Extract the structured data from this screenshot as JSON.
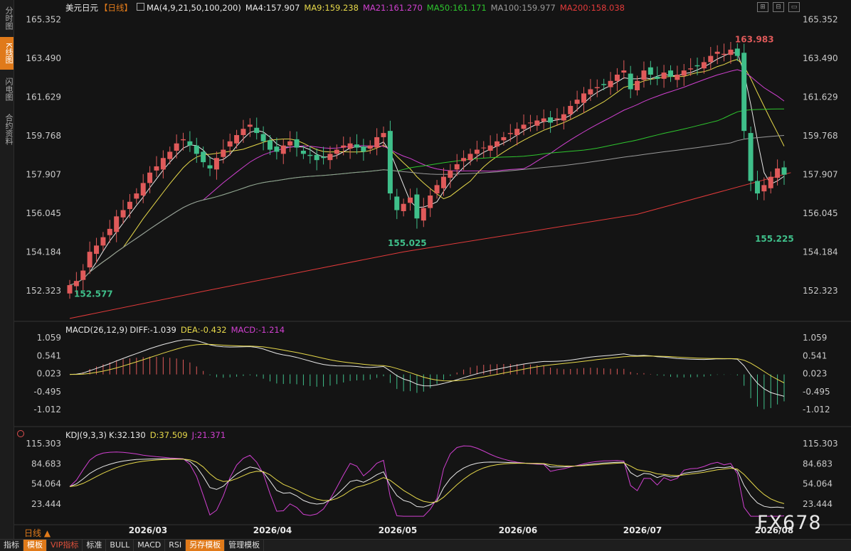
{
  "sidebar": {
    "tabs": [
      "分时图",
      "K线图",
      "闪电图",
      "合约资料"
    ],
    "active": 1
  },
  "header": {
    "symbol": "美元日元",
    "period": "【日线】",
    "ma_params": "MA(4,9,21,50,100,200)",
    "ma_values": [
      {
        "label": "MA4:157.907",
        "color": "#e8e8e8"
      },
      {
        "label": "MA9:159.238",
        "color": "#e6d84a"
      },
      {
        "label": "MA21:161.270",
        "color": "#d040d0"
      },
      {
        "label": "MA50:161.171",
        "color": "#2ec62e"
      },
      {
        "label": "MA100:159.977",
        "color": "#9a9a9a"
      },
      {
        "label": "MA200:158.038",
        "color": "#e23a3a"
      }
    ]
  },
  "macd_legend": {
    "title": "MACD(26,12,9)",
    "diff": "DIFF:-1.039",
    "dea": "DEA:-0.432",
    "macd": "MACD:-1.214"
  },
  "kdj_legend": {
    "title": "KDJ(9,3,3)",
    "k": "K:32.130",
    "d": "D:37.509",
    "j": "J:21.371"
  },
  "bottom_bar": {
    "tabs": [
      "指标",
      "模板",
      "VIP指标",
      "标准",
      "BULL",
      "MACD",
      "RSI",
      "另存模板",
      "管理模板"
    ]
  },
  "period_label": "日线 ▲",
  "watermark": "FX678",
  "chart_data": {
    "type": "candlestick",
    "title": "美元日元",
    "price_axis": {
      "ticks": [
        "165.352",
        "163.490",
        "161.629",
        "159.768",
        "157.907",
        "156.045",
        "154.184",
        "152.323"
      ],
      "ylim": [
        150.93,
        165.6
      ]
    },
    "macd_axis": {
      "ticks": [
        "1.059",
        "0.541",
        "0.023",
        "-0.495",
        "-1.012"
      ]
    },
    "kdj_axis": {
      "ticks": [
        "115.303",
        "84.683",
        "54.064",
        "23.444"
      ]
    },
    "x_labels": [
      "2026/03",
      "2026/04",
      "2026/05",
      "2026/06",
      "2026/07",
      "2026/08"
    ],
    "annotations": [
      {
        "text": "152.577",
        "value": 152.577,
        "kind": "low"
      },
      {
        "text": "155.025",
        "value": 155.025,
        "kind": "low"
      },
      {
        "text": "163.983",
        "value": 163.983,
        "kind": "high"
      },
      {
        "text": "155.225",
        "value": 155.225,
        "kind": "low"
      }
    ],
    "closes": [
      152.6,
      152.8,
      153.3,
      154.2,
      154.5,
      154.9,
      155.3,
      155.9,
      156.2,
      156.6,
      157.0,
      157.5,
      158.0,
      158.3,
      158.7,
      159.0,
      159.4,
      159.6,
      159.3,
      158.9,
      158.5,
      158.2,
      158.7,
      159.1,
      159.5,
      159.8,
      160.1,
      160.3,
      159.9,
      159.5,
      159.1,
      159.0,
      159.3,
      159.5,
      159.2,
      158.9,
      158.8,
      158.6,
      158.7,
      158.9,
      159.1,
      159.3,
      159.4,
      159.2,
      159.0,
      159.3,
      159.7,
      159.9,
      157.0,
      156.2,
      156.5,
      156.8,
      155.8,
      156.3,
      156.9,
      157.4,
      157.8,
      158.1,
      158.4,
      158.7,
      158.9,
      159.1,
      159.2,
      159.3,
      159.5,
      159.7,
      159.9,
      160.1,
      160.3,
      160.4,
      160.5,
      160.6,
      160.4,
      160.6,
      160.8,
      161.2,
      161.5,
      161.8,
      162.0,
      162.1,
      162.2,
      162.4,
      162.7,
      162.9,
      162.0,
      162.4,
      162.9,
      162.7,
      162.5,
      162.8,
      162.6,
      162.7,
      162.9,
      163.0,
      163.1,
      163.3,
      163.6,
      163.8,
      163.7,
      163.9,
      163.6,
      160.0,
      157.6,
      157.0,
      157.4,
      157.8,
      158.2,
      157.9
    ],
    "moving_averages": [
      {
        "name": "MA4",
        "value": 157.907
      },
      {
        "name": "MA9",
        "value": 159.238
      },
      {
        "name": "MA21",
        "value": 161.27
      },
      {
        "name": "MA50",
        "value": 161.171
      },
      {
        "name": "MA100",
        "value": 159.977
      },
      {
        "name": "MA200",
        "value": 158.038
      }
    ],
    "ma200_points": [
      [
        0,
        151.0
      ],
      [
        20,
        152.3
      ],
      [
        50,
        154.2
      ],
      [
        85,
        156.0
      ],
      [
        108,
        158.0
      ]
    ],
    "macd": {
      "diff": -1.039,
      "dea": -0.432,
      "macd": -1.214
    },
    "kdj": {
      "k": 32.13,
      "d": 37.509,
      "j": 21.371
    },
    "grid": false,
    "colors": {
      "up": "#e05a5a",
      "down": "#3fbf8a",
      "bg": "#141414"
    }
  }
}
